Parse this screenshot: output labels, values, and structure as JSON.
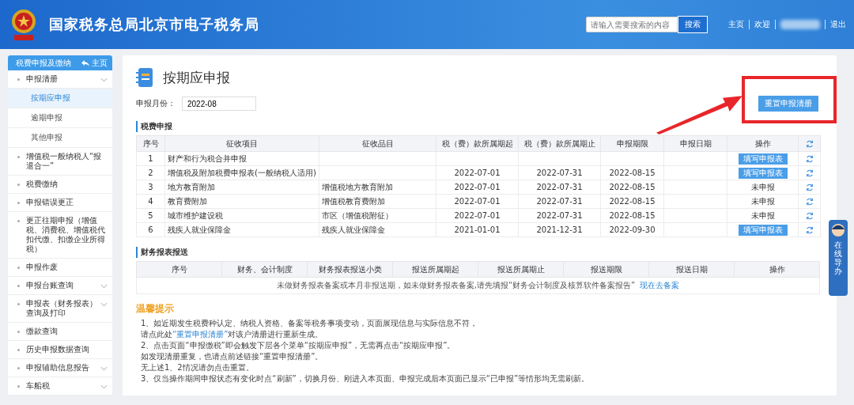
{
  "header": {
    "title": "国家税务总局北京市电子税务局",
    "search": {
      "placeholder": "请输入需要搜索的内容",
      "button": "搜索"
    },
    "links": [
      "主页",
      "欢迎"
    ],
    "logout": "退出"
  },
  "sidebar": {
    "title": "税费申报及缴纳",
    "home": "主页",
    "items": [
      {
        "label": "申报清册",
        "expandable": true,
        "children": [
          {
            "label": "按期应申报",
            "selected": true
          },
          {
            "label": "逾期申报",
            "selected": false
          },
          {
            "label": "其他申报",
            "selected": false
          }
        ]
      },
      {
        "label": "增值税一般纳税人“报退合一”",
        "expandable": false
      },
      {
        "label": "税费缴纳",
        "expandable": false
      },
      {
        "label": "申报错误更正",
        "expandable": false
      },
      {
        "label": "更正往期申报（增值税、消费税、增值税代扣代缴、扣缴企业所得税）",
        "expandable": false
      },
      {
        "label": "申报作废",
        "expandable": false
      },
      {
        "label": "申报台账查询",
        "expandable": true
      },
      {
        "label": "申报表（财务报表）查询及打印",
        "expandable": true
      },
      {
        "label": "缴款查询",
        "expandable": false
      },
      {
        "label": "历史申报数据查询",
        "expandable": false
      },
      {
        "label": "申报辅助信息报告",
        "expandable": true
      },
      {
        "label": "车船税",
        "expandable": true
      }
    ]
  },
  "page": {
    "title": "按期应申报",
    "month_label": "申报月份：",
    "month": "2022-08",
    "reset_button": "重置申报清册"
  },
  "tax_section": {
    "title": "税费申报",
    "columns": [
      "序号",
      "征收项目",
      "征收品目",
      "税（费）款所属期起",
      "税（费）款所属期止",
      "申报期限",
      "申报日期",
      "操作"
    ],
    "rows": [
      {
        "no": "1",
        "item": "财产和行为税合并申报",
        "sub": "",
        "start": "",
        "end": "",
        "deadline": "",
        "action": {
          "kind": "button",
          "text": "填写申报表"
        }
      },
      {
        "no": "2",
        "item": "增值税及附加税费申报表(一般纳税人适用)",
        "sub": "",
        "start": "2022-07-01",
        "end": "2022-07-31",
        "deadline": "2022-08-15",
        "action": {
          "kind": "button",
          "text": "填写申报表"
        }
      },
      {
        "no": "3",
        "item": "地方教育附加",
        "sub": "增值税地方教育附加",
        "start": "2022-07-01",
        "end": "2022-07-31",
        "deadline": "2022-08-15",
        "action": {
          "kind": "status",
          "text": "未申报"
        }
      },
      {
        "no": "4",
        "item": "教育费附加",
        "sub": "增值税教育费附加",
        "start": "2022-07-01",
        "end": "2022-07-31",
        "deadline": "2022-08-15",
        "action": {
          "kind": "status",
          "text": "未申报"
        }
      },
      {
        "no": "5",
        "item": "城市维护建设税",
        "sub": "市区（增值税附征）",
        "start": "2022-07-01",
        "end": "2022-07-31",
        "deadline": "2022-08-15",
        "action": {
          "kind": "status",
          "text": "未申报"
        }
      },
      {
        "no": "6",
        "item": "残疾人就业保障金",
        "sub": "残疾人就业保障金",
        "start": "2021-01-01",
        "end": "2021-12-31",
        "deadline": "2022-09-30",
        "action": {
          "kind": "button",
          "text": "填写申报表"
        }
      }
    ]
  },
  "report_section": {
    "title": "财务报表报送",
    "columns": [
      "序号",
      "财务、会计制度",
      "财务报表报送小类",
      "报送所属期起",
      "报送所属期止",
      "报送期限",
      "报送日期",
      "操作"
    ],
    "empty_message": "未做财务报表备案或本月非报送期，如未做财务报表备案,请先填报“财务会计制度及核算软件备案报告”",
    "empty_link": "现在去备案"
  },
  "tips": {
    "title": "温馨提示",
    "lines": [
      [
        {
          "text": "1、如近期发生税费种认定、纳税人资格、备案等税务事项变动，页面展现信息与实际信息不符，",
          "link": false
        }
      ],
      [
        {
          "text": "请点此处",
          "link": false
        },
        {
          "text": "“重置申报清册”",
          "link": true
        },
        {
          "text": "对该户清册进行重新生成。",
          "link": false
        }
      ],
      [
        {
          "text": "2、点击页面“申报缴税”即会触发下层各个菜单“按期应申报”，无需再点击“按期应申报”。",
          "link": false
        }
      ],
      [
        {
          "text": "如发现清册重复，也请点前述链接“重置申报清册”。",
          "link": false
        }
      ],
      [
        {
          "text": "无上述1、2情况请勿点击重置。",
          "link": false
        }
      ],
      [
        {
          "text": "3、仅当操作期间申报状态有变化时点“刷新”，切换月份、刚进入本页面、申报完成后本页面已显示“已申报”等情形均无需刷新。",
          "link": false
        }
      ]
    ]
  },
  "helper": {
    "label": "在线导办"
  }
}
